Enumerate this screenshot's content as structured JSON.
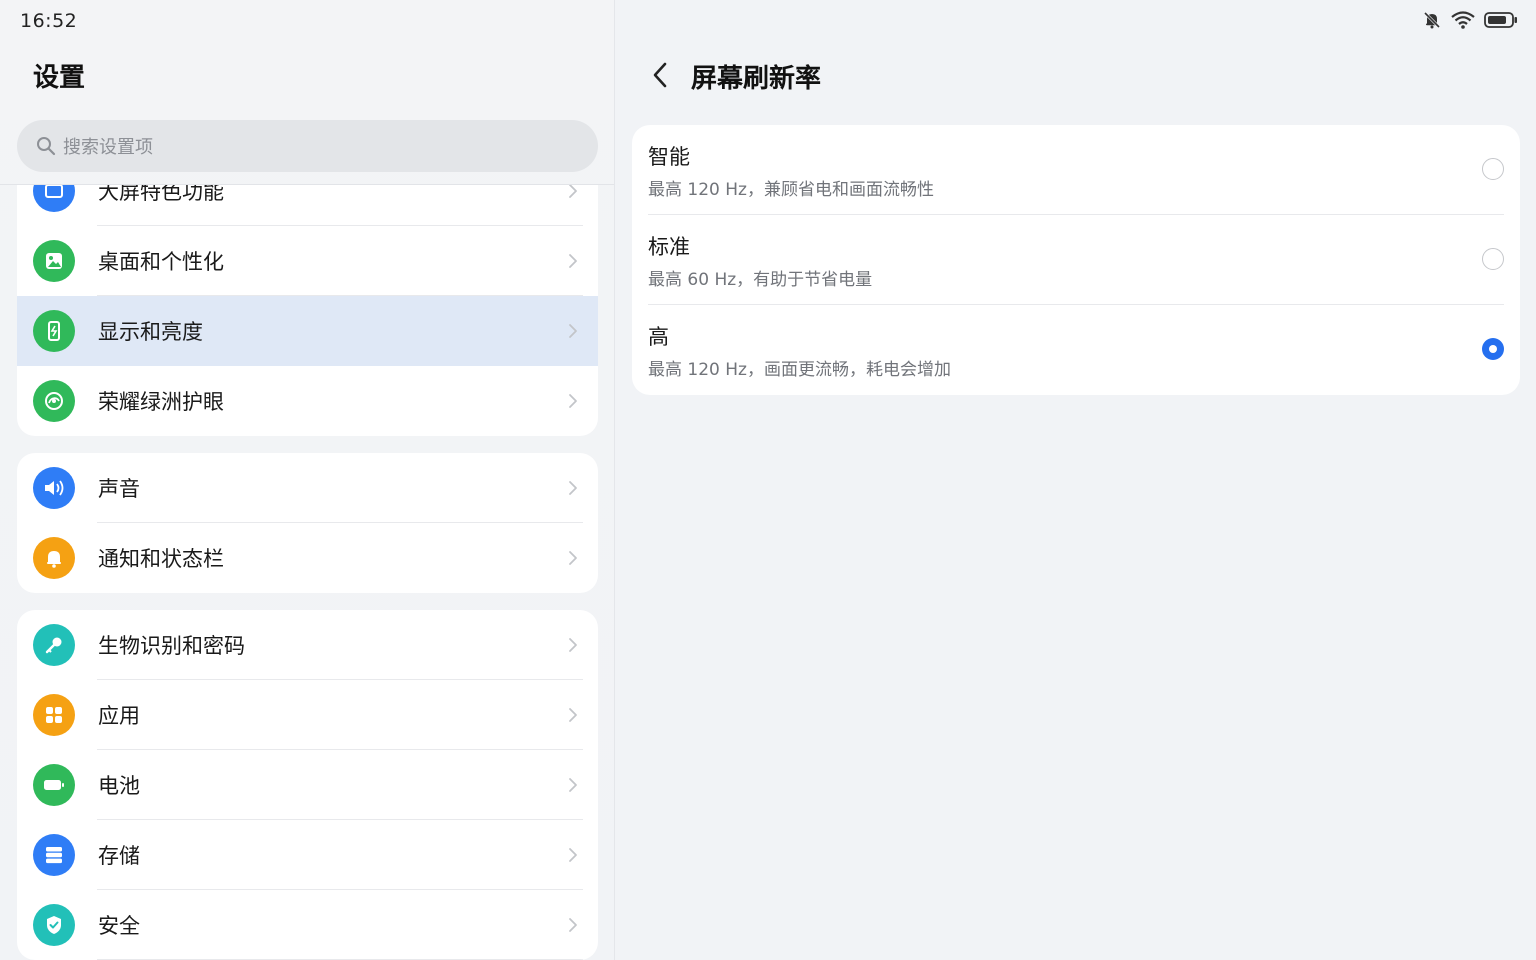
{
  "status_bar": {
    "time": "16:52",
    "icons": [
      "bell-mute-icon",
      "wifi-icon",
      "battery-icon"
    ]
  },
  "left_panel": {
    "title": "设置",
    "search": {
      "placeholder": "搜索设置项"
    },
    "groups": [
      {
        "items": [
          {
            "label": "大屏特色功能",
            "icon": "tablet-features-icon",
            "color": "#2f7df6"
          },
          {
            "label": "桌面和个性化",
            "icon": "wallpaper-icon",
            "color": "#30b95a"
          },
          {
            "label": "显示和亮度",
            "icon": "display-brightness-icon",
            "color": "#30b95a",
            "selected": true
          },
          {
            "label": "荣耀绿洲护眼",
            "icon": "eye-care-icon",
            "color": "#30b95a"
          }
        ]
      },
      {
        "items": [
          {
            "label": "声音",
            "icon": "speaker-icon",
            "color": "#2f7df6"
          },
          {
            "label": "通知和状态栏",
            "icon": "bell-icon",
            "color": "#f5a113"
          }
        ]
      },
      {
        "items": [
          {
            "label": "生物识别和密码",
            "icon": "key-icon",
            "color": "#22c0b8"
          },
          {
            "label": "应用",
            "icon": "apps-icon",
            "color": "#f5a113"
          },
          {
            "label": "电池",
            "icon": "battery-setting-icon",
            "color": "#30b95a"
          },
          {
            "label": "存储",
            "icon": "storage-icon",
            "color": "#2f7df6"
          },
          {
            "label": "安全",
            "icon": "shield-icon",
            "color": "#22c0b8"
          }
        ]
      }
    ]
  },
  "right_panel": {
    "title": "屏幕刷新率",
    "options": [
      {
        "title": "智能",
        "desc": "最高 120 Hz，兼顾省电和画面流畅性",
        "selected": false
      },
      {
        "title": "标准",
        "desc": "最高 60 Hz，有助于节省电量",
        "selected": false
      },
      {
        "title": "高",
        "desc": "最高 120 Hz，画面更流畅，耗电会增加",
        "selected": true
      }
    ]
  },
  "colors": {
    "accent": "#256fef",
    "selected_row": "#dfe8f6",
    "background": "#f1f3f6"
  }
}
